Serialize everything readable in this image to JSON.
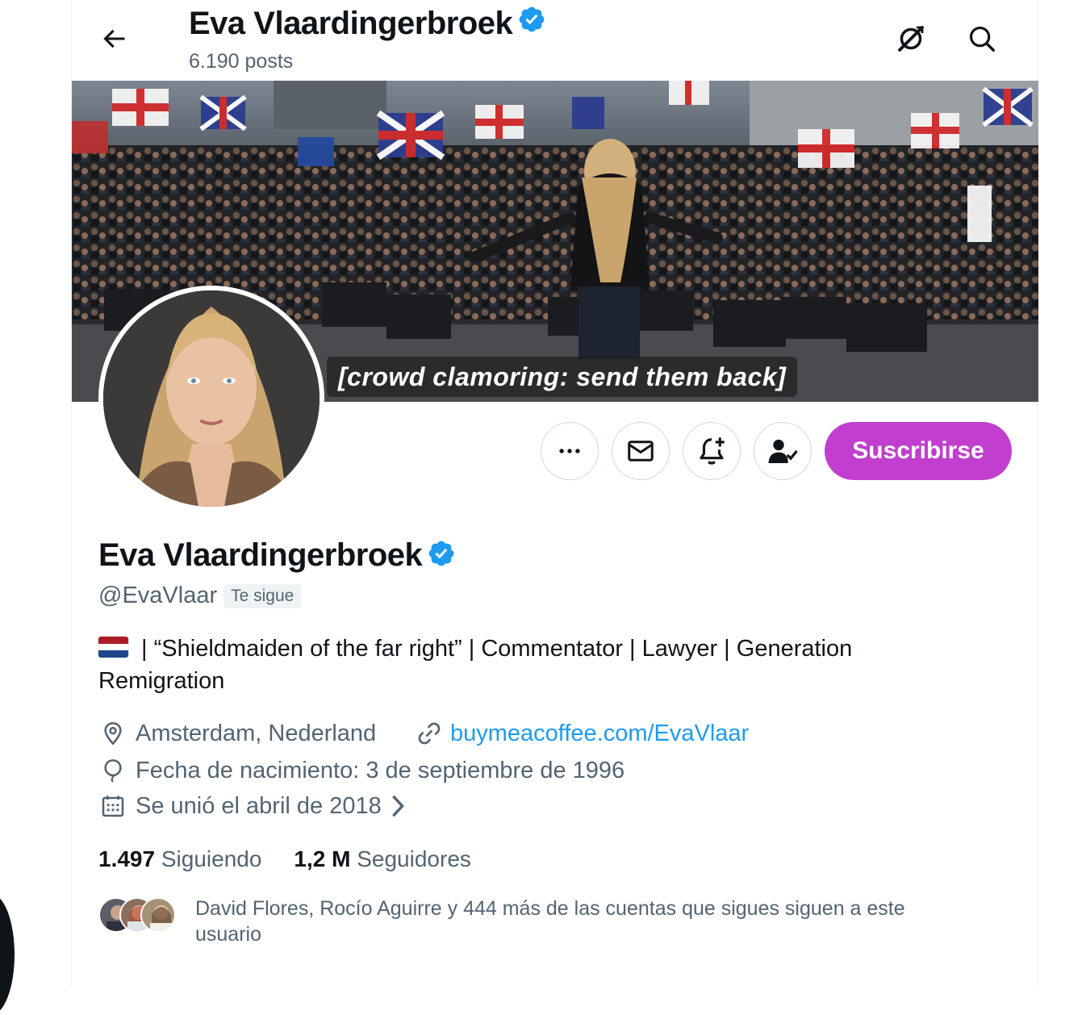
{
  "header": {
    "back_label": "Back",
    "title": "Eva Vlaardingerbroek",
    "posts_count": "6.190 posts"
  },
  "banner": {
    "caption": "[crowd clamoring: send them back]"
  },
  "actions": {
    "subscribe_label": "Suscribirse"
  },
  "profile": {
    "display_name": "Eva Vlaardingerbroek",
    "handle": "@EvaVlaar",
    "follows_you": "Te sigue",
    "bio": " | “Shieldmaiden of the far right” |  Commentator | Lawyer | Generation Remigration",
    "location": "Amsterdam, Nederland",
    "website": "buymeacoffee.com/EvaVlaar",
    "birthday": "Fecha de nacimiento: 3 de septiembre de 1996",
    "joined": "Se unió el abril de 2018"
  },
  "stats": {
    "following_count": "1.497",
    "following_label": "Siguiendo",
    "followers_count": "1,2 M",
    "followers_label": "Seguidores"
  },
  "known_followers": {
    "text": "David Flores, Rocío Aguirre y 444 más de las cuentas que sigues siguen a este usuario"
  },
  "colors": {
    "accent_blue": "#1d9bf0",
    "subscribe_purple": "#c13ece",
    "verified_blue": "#1d9bf0",
    "muted_text": "#536471"
  },
  "icons": {
    "back": "arrow-left-icon",
    "grok": "grok-icon",
    "search": "search-icon",
    "more": "more-dots-icon",
    "message": "envelope-icon",
    "notify": "bell-plus-icon",
    "following": "person-check-icon",
    "location": "location-pin-icon",
    "link": "link-icon",
    "birthday": "balloon-icon",
    "calendar": "calendar-icon",
    "verified": "verified-badge-icon"
  }
}
